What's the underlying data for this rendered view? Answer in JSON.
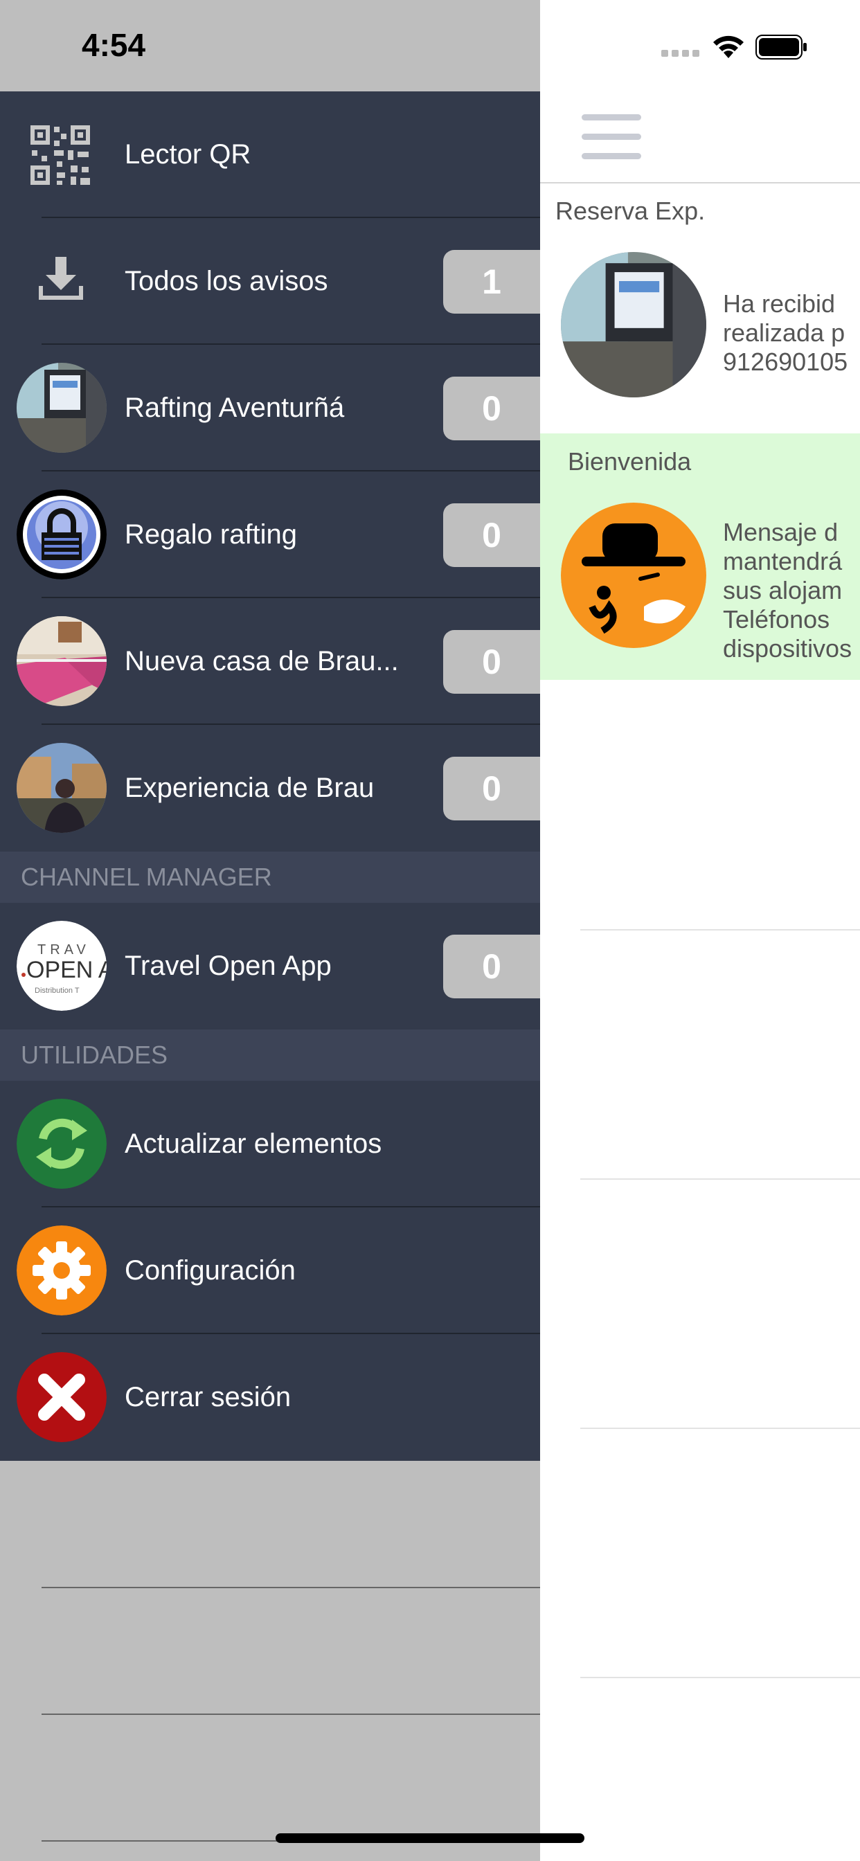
{
  "status_bar": {
    "time": "4:54"
  },
  "drawer": {
    "items": [
      {
        "label": "Lector QR",
        "icon": "qr-code-icon"
      },
      {
        "label": "Todos los avisos",
        "icon": "download-icon",
        "badge": "1"
      },
      {
        "label": "Rafting Aventurñá",
        "icon": "computer-photo-avatar",
        "badge": "0"
      },
      {
        "label": "Regalo rafting",
        "icon": "padlock-avatar",
        "badge": "0"
      },
      {
        "label": "Nueva casa de Brau...",
        "icon": "bedroom-photo-avatar",
        "badge": "0"
      },
      {
        "label": "Experiencia de Brau",
        "icon": "person-photo-avatar",
        "badge": "0"
      }
    ],
    "channel_manager": {
      "header": "CHANNEL MANAGER",
      "items": [
        {
          "label": "Travel Open App",
          "icon": "travel-open-app-logo",
          "badge": "0"
        }
      ]
    },
    "utilities": {
      "header": "UTILIDADES",
      "items": [
        {
          "label": "Actualizar elementos",
          "icon": "refresh-icon"
        },
        {
          "label": "Configuración",
          "icon": "gear-icon"
        },
        {
          "label": "Cerrar sesión",
          "icon": "close-icon"
        }
      ]
    }
  },
  "main": {
    "notifications": [
      {
        "title": "Reserva Exp.",
        "lines": [
          "Ha recibid",
          "realizada p",
          "912690105"
        ]
      },
      {
        "title": "Bienvenida",
        "lines": [
          "Mensaje d",
          "mantendrá",
          "sus alojam",
          "Teléfonos",
          "dispositivos"
        ]
      }
    ]
  },
  "colors": {
    "drawer_bg": "#333a4b",
    "section_header_bg": "#3d4457",
    "badge_bg": "#bfbfbf",
    "welcome_bg": "#dcfad8",
    "overlay_gray": "#bebebe"
  }
}
